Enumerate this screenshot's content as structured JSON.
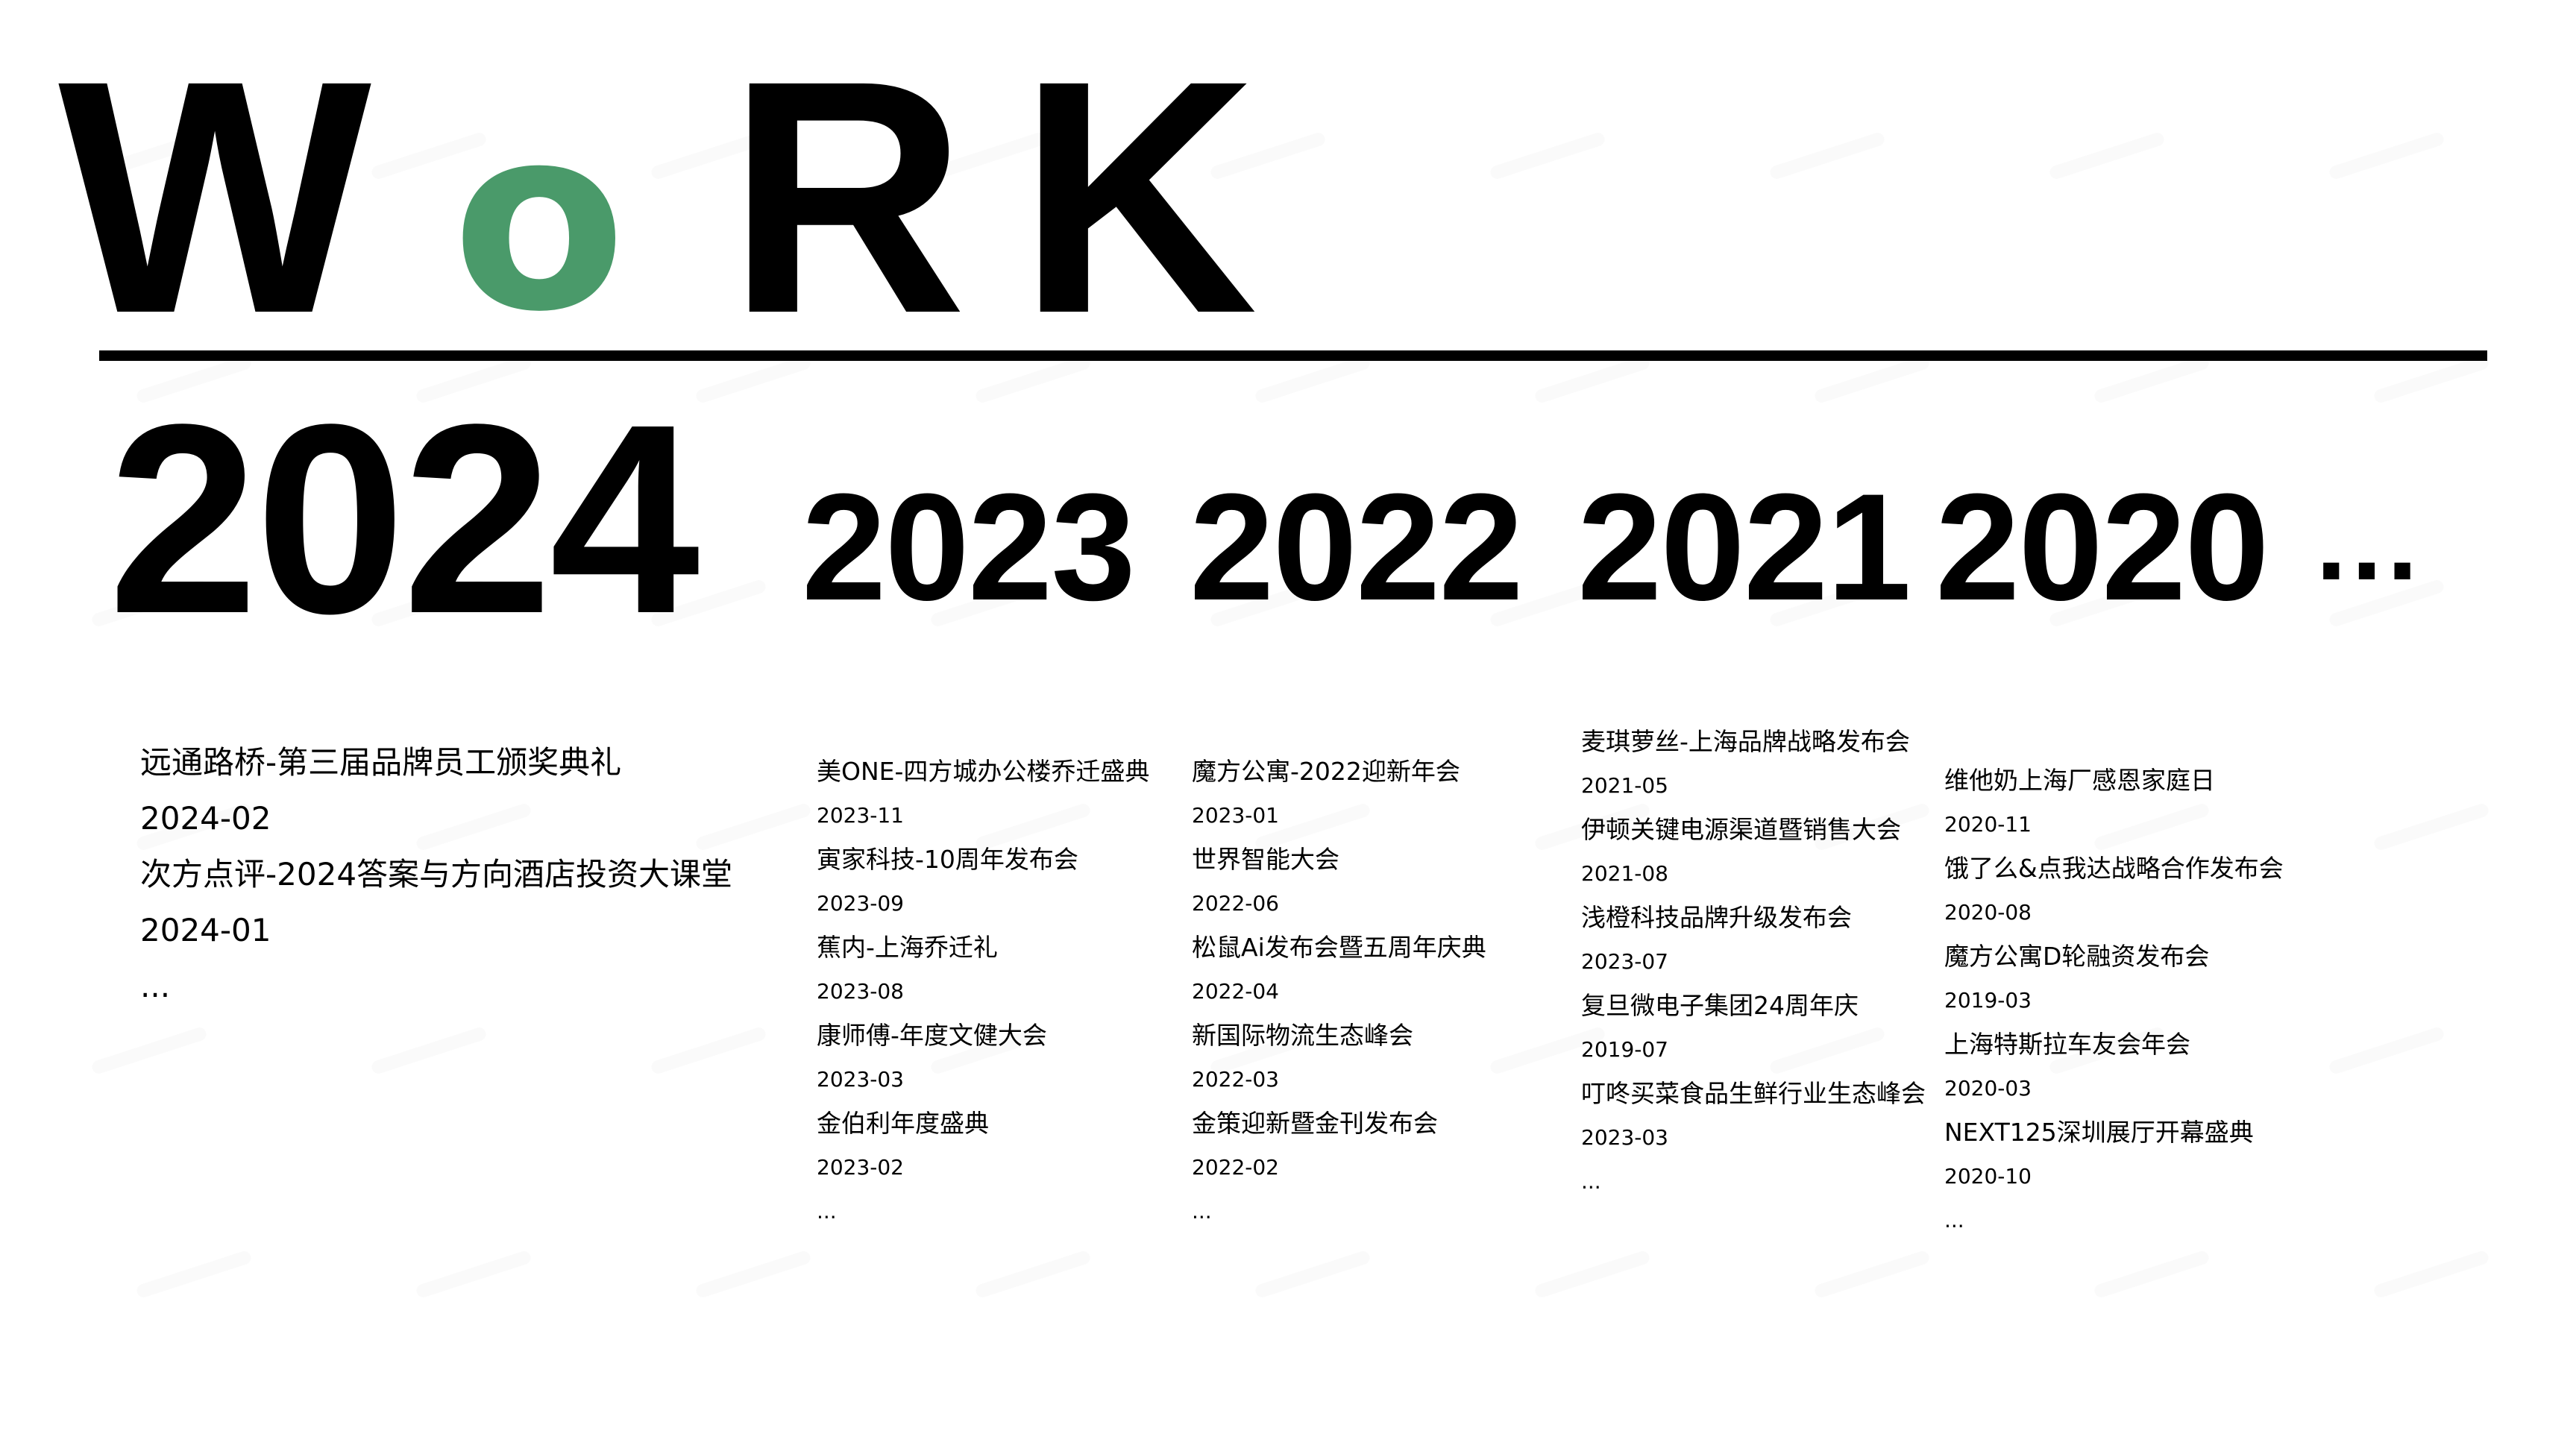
{
  "title": {
    "w": "W",
    "o": "o",
    "r": "R",
    "k": "K",
    "accent_color": "#4a9a6a"
  },
  "years": {
    "y2024": "2024",
    "y2023": "2023",
    "y2022": "2022",
    "y2021": "2021",
    "y2020": "2020",
    "more": "..."
  },
  "columns": [
    {
      "items": [
        {
          "name": "远通路桥-第三届品牌员工颁奖典礼",
          "date": "2024-02"
        },
        {
          "name": "次方点评-2024答案与方向酒店投资大课堂",
          "date": "2024-01"
        }
      ],
      "more": "..."
    },
    {
      "items": [
        {
          "name": "美ONE-四方城办公楼乔迁盛典",
          "date": "2023-11"
        },
        {
          "name": "寅家科技-10周年发布会",
          "date": "2023-09"
        },
        {
          "name": "蕉内-上海乔迁礼",
          "date": "2023-08"
        },
        {
          "name": "康师傅-年度文健大会",
          "date": "2023-03"
        },
        {
          "name": "金伯利年度盛典",
          "date": "2023-02"
        }
      ],
      "more": "..."
    },
    {
      "items": [
        {
          "name": "魔方公寓-2022迎新年会",
          "date": "2023-01"
        },
        {
          "name": "世界智能大会",
          "date": "2022-06"
        },
        {
          "name": "松鼠Ai发布会暨五周年庆典",
          "date": "2022-04"
        },
        {
          "name": "新国际物流生态峰会",
          "date": "2022-03"
        },
        {
          "name": "金策迎新暨金刊发布会",
          "date": "2022-02"
        }
      ],
      "more": "..."
    },
    {
      "items": [
        {
          "name": "麦琪萝丝-上海品牌战略发布会",
          "date": "2021-05"
        },
        {
          "name": "伊顿关键电源渠道暨销售大会",
          "date": "2021-08"
        },
        {
          "name": "浅橙科技品牌升级发布会",
          "date": "2023-07"
        },
        {
          "name": "复旦微电子集团24周年庆",
          "date": "2019-07"
        },
        {
          "name": "叮咚买菜食品生鲜行业生态峰会",
          "date": "2023-03"
        }
      ],
      "more": "..."
    },
    {
      "items": [
        {
          "name": "维他奶上海厂感恩家庭日",
          "date": "2020-11"
        },
        {
          "name": "饿了么&点我达战略合作发布会",
          "date": "2020-08"
        },
        {
          "name": "魔方公寓D轮融资发布会",
          "date": "2019-03"
        },
        {
          "name": "上海特斯拉车友会年会",
          "date": "2020-03"
        },
        {
          "name": "NEXT125深圳展厅开幕盛典",
          "date": "2020-10"
        }
      ],
      "more": "..."
    }
  ]
}
